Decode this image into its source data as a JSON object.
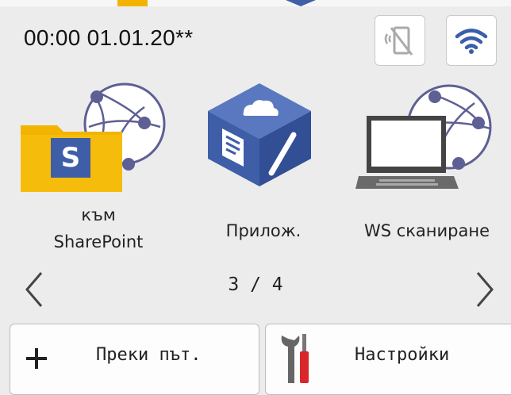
{
  "status": {
    "datetime": "00:00  01.01.20**",
    "nfc_icon": "nfc-disabled-icon",
    "wifi_icon": "wifi-icon"
  },
  "apps": [
    {
      "label_line1": "към",
      "label_line2": "SharePoint",
      "icon": "sharepoint-folder-icon",
      "accent": "#f2b400"
    },
    {
      "label": "Прилож.",
      "icon": "apps-cube-icon",
      "accent": "#3f5ea8"
    },
    {
      "label": "WS сканиране",
      "icon": "ws-scan-laptop-icon",
      "accent": "#555555"
    }
  ],
  "pager": {
    "text": "3 / 4"
  },
  "bottom": {
    "shortcuts_label": "Преки път.",
    "settings_label": "Настройки"
  }
}
